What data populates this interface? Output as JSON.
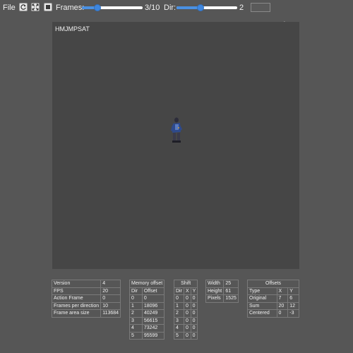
{
  "toolbar": {
    "file_label": "File",
    "frames_label": "Frames:",
    "frames_value": "3/10",
    "frames_fraction": 0.25,
    "dir_label": "Dir:",
    "dir_value": "2",
    "dir_fraction": 0.4,
    "icons": [
      "refresh-icon",
      "fit-to-screen-icon",
      "stop-icon"
    ]
  },
  "canvas": {
    "sprite_name": "HMJMPSAT"
  },
  "general": {
    "rows": [
      [
        "Version",
        "4"
      ],
      [
        "FPS",
        "20"
      ],
      [
        "Action Frame",
        "0"
      ],
      [
        "Frames per direction",
        "10"
      ],
      [
        "Frame area size",
        "113684"
      ]
    ]
  },
  "memory_offset": {
    "title": "Memory offset",
    "headers": [
      "Dir",
      "Offset"
    ],
    "rows": [
      [
        "0",
        "0"
      ],
      [
        "1",
        "18096"
      ],
      [
        "2",
        "40249"
      ],
      [
        "3",
        "56615"
      ],
      [
        "4",
        "73242"
      ],
      [
        "5",
        "95599"
      ]
    ]
  },
  "shift": {
    "title": "Shift",
    "headers": [
      "Dir",
      "X",
      "Y"
    ],
    "rows": [
      [
        "0",
        "0",
        "0"
      ],
      [
        "1",
        "0",
        "0"
      ],
      [
        "2",
        "0",
        "0"
      ],
      [
        "3",
        "0",
        "0"
      ],
      [
        "4",
        "0",
        "0"
      ],
      [
        "5",
        "0",
        "0"
      ]
    ]
  },
  "size": {
    "rows": [
      [
        "Width",
        "25"
      ],
      [
        "Height",
        "61"
      ],
      [
        "Pixels",
        "1525"
      ]
    ]
  },
  "offsets": {
    "title": "Offsets",
    "headers": [
      "Type",
      "X",
      "Y"
    ],
    "rows": [
      [
        "Original",
        "7",
        "6"
      ],
      [
        "Sum",
        "20",
        "12"
      ],
      [
        "Centered",
        "0",
        "-3"
      ]
    ]
  }
}
